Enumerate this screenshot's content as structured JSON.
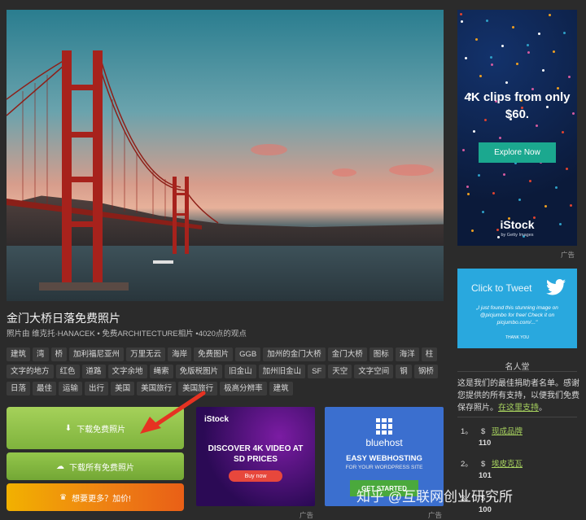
{
  "photo": {
    "title": "金门大桥日落免费照片",
    "meta": "照片由 维克托·HANACEK • 免费ARCHITECTURE相片 •4020点的观点"
  },
  "tags": [
    "建筑",
    "湾",
    "桥",
    "加利福尼亚州",
    "万里无云",
    "海岸",
    "免费图片",
    "GGB",
    "加州的金门大桥",
    "金门大桥",
    "图标",
    "海洋",
    "柱",
    "文字的地方",
    "红色",
    "道路",
    "文字余地",
    "绳索",
    "免版税图片",
    "旧金山",
    "加州旧金山",
    "SF",
    "天空",
    "文字空间",
    "钢",
    "钢桥",
    "日落",
    "最佳",
    "运输",
    "出行",
    "美国",
    "美国旅行",
    "美国旅行",
    "极高分辨率",
    "建筑"
  ],
  "buttons": {
    "download": "下载免费照片",
    "download_all": "下载所有免费照片",
    "more": "想要更多？加价!"
  },
  "ad_istock": {
    "logo": "iStock",
    "headline": "DISCOVER 4K VIDEO AT SD PRICES",
    "cta": "Buy now"
  },
  "ad_bluehost": {
    "brand": "bluehost",
    "headline": "EASY WEBHOSTING",
    "sub": "FOR YOUR WORDPRESS SITE",
    "cta": "GET STARTED"
  },
  "ad_label": "广告",
  "sidebar_ad": {
    "headline": "4K clips from only $60.",
    "cta": "Explore Now",
    "brand": "iStock",
    "brand_sub": "by Getty Images"
  },
  "tweet": {
    "title": "Click to Tweet",
    "quote": "„I just found this stunning image on @picjumbo for free! Check it on picjumbo.com/...\"",
    "thanks": "THANK YOU"
  },
  "hall": {
    "title": "名人堂",
    "text": "这是我们的最佳捐助者名单。感谢您提供的所有支持，以便我们免费保存照片。",
    "link": "在这里支持",
    "after": "。"
  },
  "donors": [
    {
      "rank": "1。",
      "currency": "$",
      "name": "现成品牌",
      "amount": "110"
    },
    {
      "rank": "2。",
      "currency": "$",
      "name": "埃皮克瓦",
      "amount": "101"
    },
    {
      "rank": "3。",
      "currency": "$",
      "name": "",
      "amount": "100"
    }
  ],
  "watermark": "知乎 @互联网创业研究所"
}
